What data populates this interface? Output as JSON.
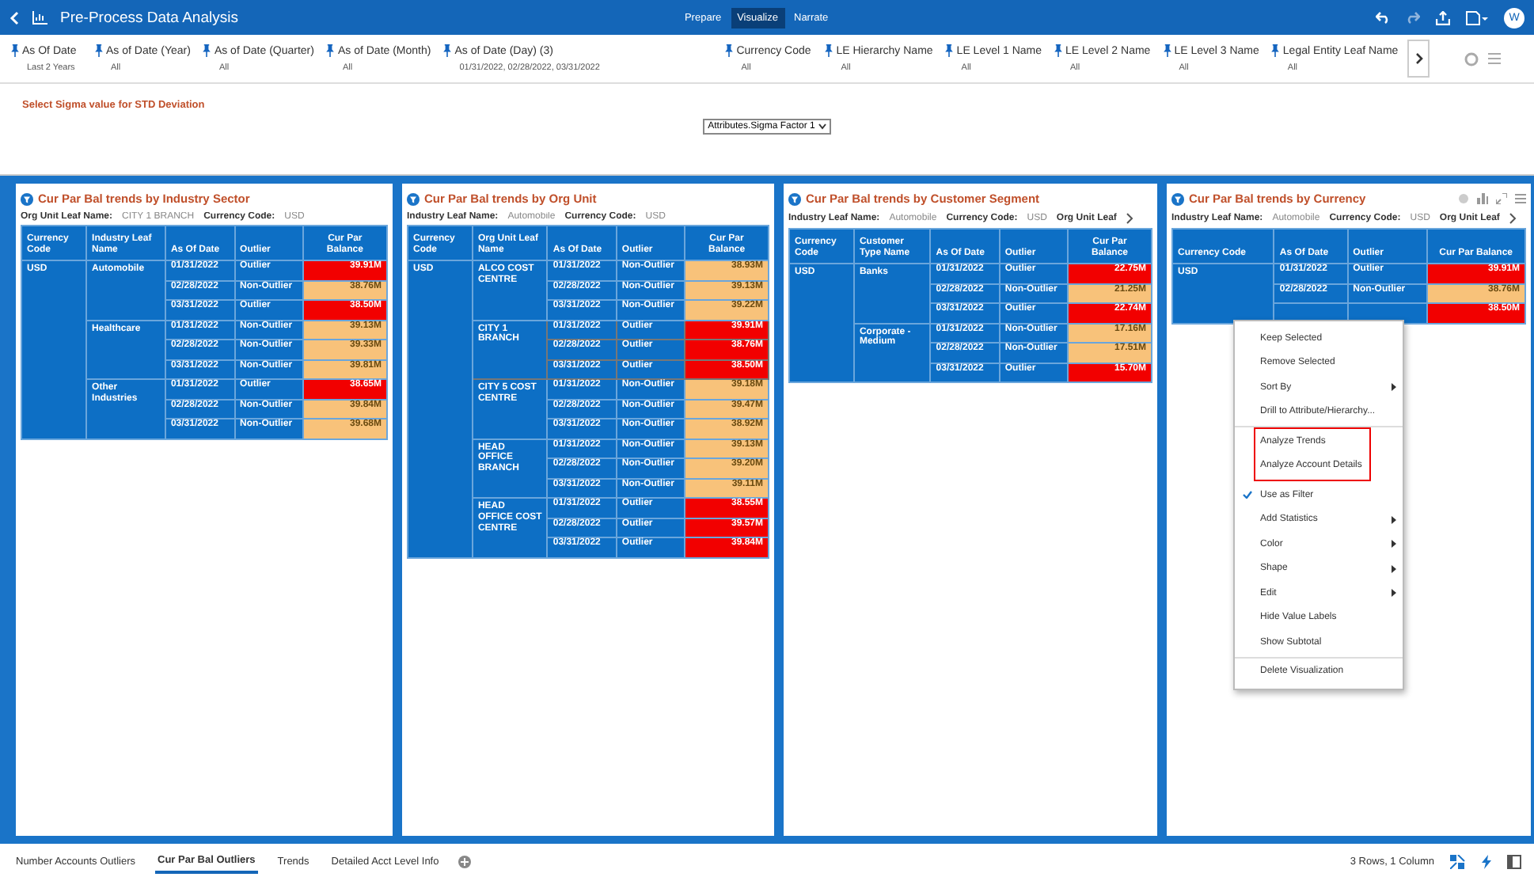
{
  "top_bar": {
    "title": "Pre-Process Data Analysis",
    "avatar": "W",
    "modes": [
      {
        "label": "Prepare",
        "selected": false
      },
      {
        "label": "Visualize",
        "selected": true
      },
      {
        "label": "Narrate",
        "selected": false
      }
    ]
  },
  "filters": [
    {
      "label": "As Of Date",
      "value": "Last 2 Years"
    },
    {
      "label": "As of Date (Year)",
      "value": "All"
    },
    {
      "label": "As of Date (Quarter)",
      "value": "All"
    },
    {
      "label": "As of Date (Month)",
      "value": "All"
    },
    {
      "label": "As of Date (Day) (3)",
      "value": "01/31/2022, 02/28/2022, 03/31/2022"
    },
    {
      "label": "Currency Code",
      "value": "All"
    },
    {
      "label": "LE Hierarchy Name",
      "value": "All"
    },
    {
      "label": "LE Level 1 Name",
      "value": "All"
    },
    {
      "label": "LE Level 2 Name",
      "value": "All"
    },
    {
      "label": "LE Level 3 Name",
      "value": "All"
    },
    {
      "label": "Legal Entity Leaf Name",
      "value": "All"
    }
  ],
  "sigma": {
    "label": "Select Sigma value for STD Deviation",
    "value": "Attributes.Sigma Factor 1"
  },
  "panels": [
    {
      "title": "Cur Par Bal trends by Industry Sector",
      "more": false,
      "toolbar": false,
      "filters": [
        {
          "label": "Org Unit Leaf Name:",
          "value": "CITY 1 BRANCH"
        },
        {
          "label": "Currency Code:",
          "value": "USD"
        }
      ],
      "columns": [
        "Currency Code",
        "Industry Leaf Name",
        "As Of Date",
        "Outlier",
        "Cur Par Balance"
      ],
      "groups": [
        {
          "label": "USD",
          "selected": false,
          "children": [
            {
              "label": "Automobile",
              "selected": false,
              "rows": [
                {
                  "date": "01/31/2022",
                  "outlier": "Outlier",
                  "value": "39.91M",
                  "flagged": true
                },
                {
                  "date": "02/28/2022",
                  "outlier": "Non-Outlier",
                  "value": "38.76M",
                  "flagged": false
                },
                {
                  "date": "03/31/2022",
                  "outlier": "Outlier",
                  "value": "38.50M",
                  "flagged": true
                }
              ]
            },
            {
              "label": "Healthcare",
              "selected": false,
              "rows": [
                {
                  "date": "01/31/2022",
                  "outlier": "Non-Outlier",
                  "value": "39.13M",
                  "flagged": false
                },
                {
                  "date": "02/28/2022",
                  "outlier": "Non-Outlier",
                  "value": "39.33M",
                  "flagged": false
                },
                {
                  "date": "03/31/2022",
                  "outlier": "Non-Outlier",
                  "value": "39.81M",
                  "flagged": false
                }
              ]
            },
            {
              "label": "Other Industries",
              "selected": false,
              "rows": [
                {
                  "date": "01/31/2022",
                  "outlier": "Outlier",
                  "value": "38.65M",
                  "flagged": true
                },
                {
                  "date": "02/28/2022",
                  "outlier": "Non-Outlier",
                  "value": "39.84M",
                  "flagged": false
                },
                {
                  "date": "03/31/2022",
                  "outlier": "Non-Outlier",
                  "value": "39.68M",
                  "flagged": false
                }
              ]
            }
          ]
        }
      ]
    },
    {
      "title": "Cur Par Bal trends by Org Unit",
      "more": false,
      "toolbar": false,
      "filters": [
        {
          "label": "Industry Leaf Name:",
          "value": "Automobile"
        },
        {
          "label": "Currency Code:",
          "value": "USD"
        }
      ],
      "columns": [
        "Currency Code",
        "Org Unit Leaf Name",
        "As Of Date",
        "Outlier",
        "Cur Par Balance"
      ],
      "groups": [
        {
          "label": "USD",
          "selected": false,
          "children": [
            {
              "label": "ALCO COST CENTRE",
              "selected": false,
              "rows": [
                {
                  "date": "01/31/2022",
                  "outlier": "Non-Outlier",
                  "value": "38.93M",
                  "flagged": false
                },
                {
                  "date": "02/28/2022",
                  "outlier": "Non-Outlier",
                  "value": "39.13M",
                  "flagged": false
                },
                {
                  "date": "03/31/2022",
                  "outlier": "Non-Outlier",
                  "value": "39.22M",
                  "flagged": false
                }
              ]
            },
            {
              "label": "CITY 1 BRANCH",
              "selected": true,
              "rows": [
                {
                  "date": "01/31/2022",
                  "outlier": "Outlier",
                  "value": "39.91M",
                  "flagged": true
                },
                {
                  "date": "02/28/2022",
                  "outlier": "Outlier",
                  "value": "38.76M",
                  "flagged": true
                },
                {
                  "date": "03/31/2022",
                  "outlier": "Outlier",
                  "value": "38.50M",
                  "flagged": true
                }
              ]
            },
            {
              "label": "CITY 5 COST CENTRE",
              "selected": false,
              "rows": [
                {
                  "date": "01/31/2022",
                  "outlier": "Non-Outlier",
                  "value": "39.18M",
                  "flagged": false
                },
                {
                  "date": "02/28/2022",
                  "outlier": "Non-Outlier",
                  "value": "39.47M",
                  "flagged": false
                },
                {
                  "date": "03/31/2022",
                  "outlier": "Non-Outlier",
                  "value": "38.92M",
                  "flagged": false
                }
              ]
            },
            {
              "label": "HEAD OFFICE BRANCH",
              "selected": false,
              "rows": [
                {
                  "date": "01/31/2022",
                  "outlier": "Non-Outlier",
                  "value": "39.13M",
                  "flagged": false
                },
                {
                  "date": "02/28/2022",
                  "outlier": "Non-Outlier",
                  "value": "39.20M",
                  "flagged": false
                },
                {
                  "date": "03/31/2022",
                  "outlier": "Non-Outlier",
                  "value": "39.11M",
                  "flagged": false
                }
              ]
            },
            {
              "label": "HEAD OFFICE COST CENTRE",
              "selected": false,
              "rows": [
                {
                  "date": "01/31/2022",
                  "outlier": "Outlier",
                  "value": "38.55M",
                  "flagged": true
                },
                {
                  "date": "02/28/2022",
                  "outlier": "Outlier",
                  "value": "39.57M",
                  "flagged": true
                },
                {
                  "date": "03/31/2022",
                  "outlier": "Outlier",
                  "value": "39.84M",
                  "flagged": true
                }
              ]
            }
          ]
        }
      ]
    },
    {
      "title": "Cur Par Bal trends by Customer Segment",
      "more": true,
      "toolbar": false,
      "filters": [
        {
          "label": "Industry Leaf Name:",
          "value": "Automobile"
        },
        {
          "label": "Currency Code:",
          "value": "USD"
        },
        {
          "label": "Org Unit Leaf"
        }
      ],
      "columns": [
        "Currency Code",
        "Customer Type Name",
        "As Of Date",
        "Outlier",
        "Cur Par Balance"
      ],
      "groups": [
        {
          "label": "USD",
          "selected": false,
          "children": [
            {
              "label": "Banks",
              "selected": false,
              "rows": [
                {
                  "date": "01/31/2022",
                  "outlier": "Outlier",
                  "value": "22.75M",
                  "flagged": true
                },
                {
                  "date": "02/28/2022",
                  "outlier": "Non-Outlier",
                  "value": "21.25M",
                  "flagged": false
                },
                {
                  "date": "03/31/2022",
                  "outlier": "Outlier",
                  "value": "22.74M",
                  "flagged": true
                }
              ]
            },
            {
              "label": "Corporate - Medium",
              "selected": false,
              "rows": [
                {
                  "date": "01/31/2022",
                  "outlier": "Non-Outlier",
                  "value": "17.16M",
                  "flagged": false
                },
                {
                  "date": "02/28/2022",
                  "outlier": "Non-Outlier",
                  "value": "17.51M",
                  "flagged": false
                },
                {
                  "date": "03/31/2022",
                  "outlier": "Outlier",
                  "value": "15.70M",
                  "flagged": true
                }
              ]
            }
          ]
        }
      ]
    },
    {
      "title": "Cur Par Bal trends by Currency",
      "more": true,
      "toolbar": true,
      "filters": [
        {
          "label": "Industry Leaf Name:",
          "value": "Automobile"
        },
        {
          "label": "Currency Code:",
          "value": "USD"
        },
        {
          "label": "Org Unit Leaf"
        }
      ],
      "columns": [
        "Currency Code",
        "As Of Date",
        "Outlier",
        "Cur Par Balance"
      ],
      "groups": [
        {
          "label": "USD",
          "selected": false,
          "rows": [
            {
              "date": "01/31/2022",
              "outlier": "Outlier",
              "value": "39.91M",
              "flagged": true
            },
            {
              "date": "02/28/2022",
              "outlier": "Non-Outlier",
              "value": "38.76M",
              "flagged": false
            },
            {
              "value": "38.50M",
              "flagged": true
            }
          ]
        }
      ]
    }
  ],
  "context_menu": {
    "sections": [
      {
        "highlighted": false,
        "items": [
          {
            "label": "Keep Selected",
            "submenu": false,
            "checked": false
          },
          {
            "label": "Remove Selected",
            "submenu": false,
            "checked": false
          },
          {
            "label": "Sort By",
            "submenu": true,
            "checked": false
          },
          {
            "label": "Drill to Attribute/Hierarchy...",
            "submenu": false,
            "checked": false
          }
        ]
      },
      {
        "highlighted": true,
        "items": [
          {
            "label": "Analyze Trends",
            "submenu": false,
            "checked": false
          },
          {
            "label": "Analyze Account Details",
            "submenu": false,
            "checked": false
          }
        ]
      },
      {
        "highlighted": false,
        "items": [
          {
            "label": "Use as Filter",
            "submenu": false,
            "checked": true
          },
          {
            "label": "Add Statistics",
            "submenu": true,
            "checked": false
          },
          {
            "label": "Color",
            "submenu": true,
            "checked": false
          },
          {
            "label": "Shape",
            "submenu": true,
            "checked": false
          },
          {
            "label": "Edit",
            "submenu": true,
            "checked": false
          },
          {
            "label": "Hide Value Labels",
            "submenu": false,
            "checked": false
          },
          {
            "label": "Show Subtotal",
            "submenu": false,
            "checked": false
          }
        ]
      },
      {
        "highlighted": false,
        "items": [
          {
            "label": "Delete Visualization",
            "submenu": false,
            "checked": false
          }
        ]
      }
    ]
  },
  "tabs": [
    {
      "label": "Number Accounts Outliers",
      "selected": false
    },
    {
      "label": "Cur Par Bal Outliers",
      "selected": true
    },
    {
      "label": "Trends",
      "selected": false
    },
    {
      "label": "Detailed Acct Level Info",
      "selected": false
    }
  ],
  "status": "3 Rows, 1 Column"
}
